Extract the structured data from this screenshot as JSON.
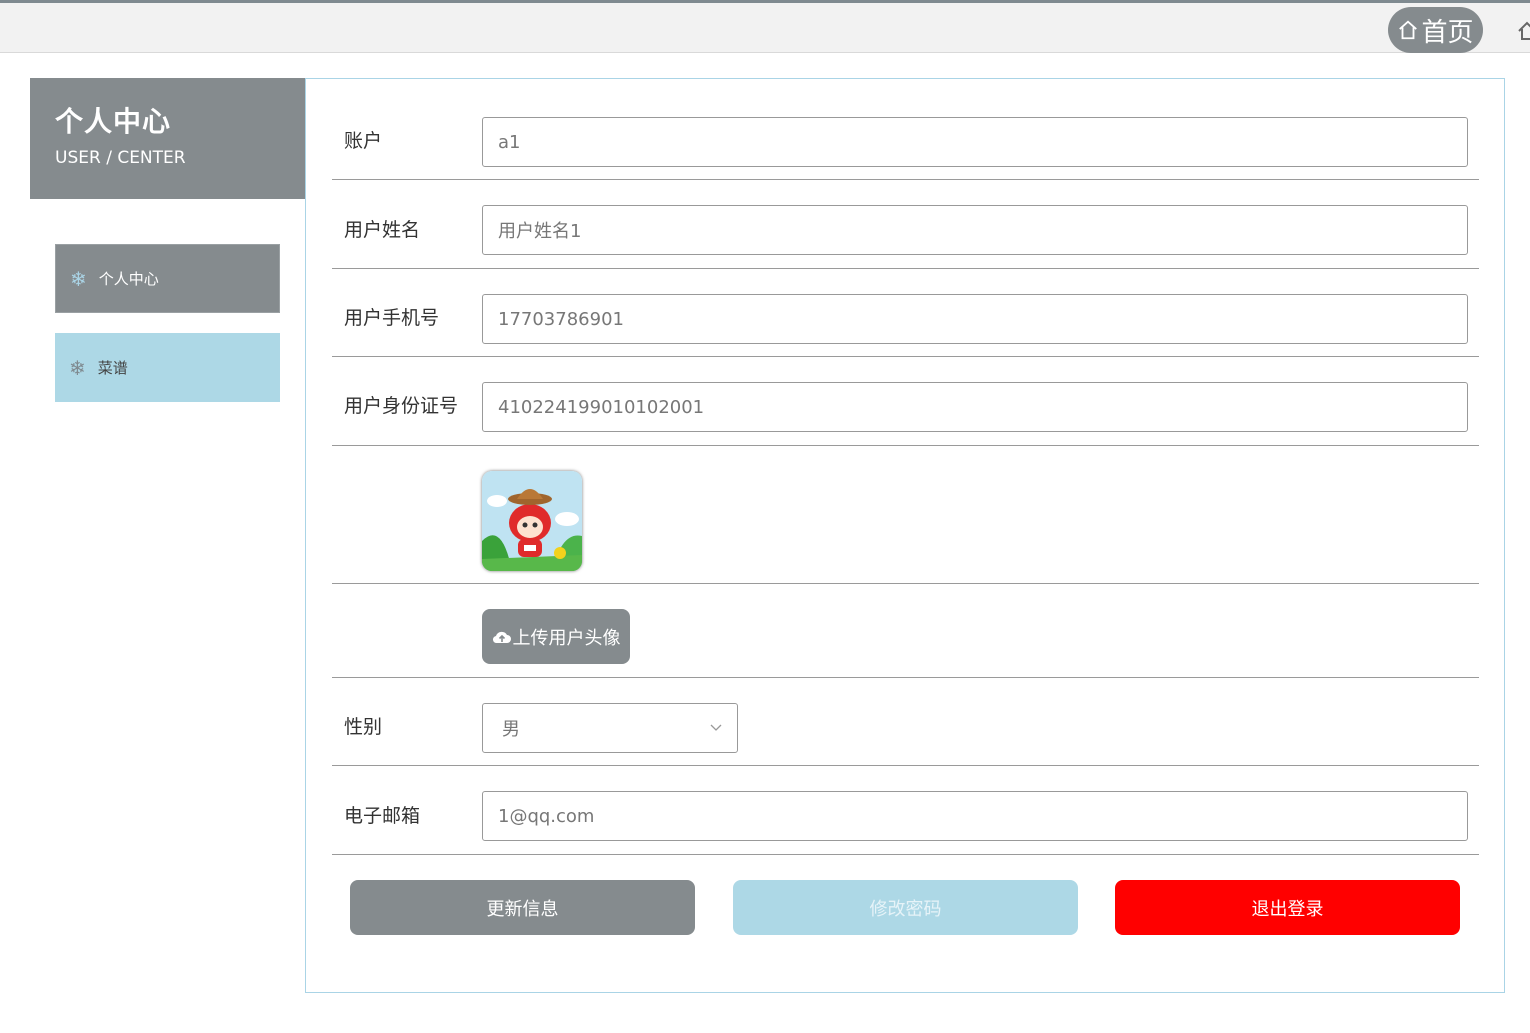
{
  "topbar": {
    "home_label": "首页",
    "home_icon": "home-icon"
  },
  "sidebar": {
    "title": "个人中心",
    "subtitle": "USER / CENTER",
    "items": [
      {
        "label": "个人中心",
        "icon": "snowflake-icon",
        "active": true
      },
      {
        "label": "菜谱",
        "icon": "snowflake-icon",
        "active": false
      }
    ]
  },
  "form": {
    "account": {
      "label": "账户",
      "value": "a1"
    },
    "username": {
      "label": "用户姓名",
      "value": "用户姓名1"
    },
    "phone": {
      "label": "用户手机号",
      "value": "17703786901"
    },
    "idcard": {
      "label": "用户身份证号",
      "value": "410224199010102001"
    },
    "upload_label": "上传用户头像",
    "gender": {
      "label": "性别",
      "value": "男"
    },
    "email": {
      "label": "电子邮箱",
      "value": "1@qq.com"
    }
  },
  "buttons": {
    "update": "更新信息",
    "change_password": "修改密码",
    "logout": "退出登录"
  },
  "colors": {
    "primary_gray": "#858b8e",
    "light_blue": "#add8e6",
    "danger": "#ff0000"
  }
}
